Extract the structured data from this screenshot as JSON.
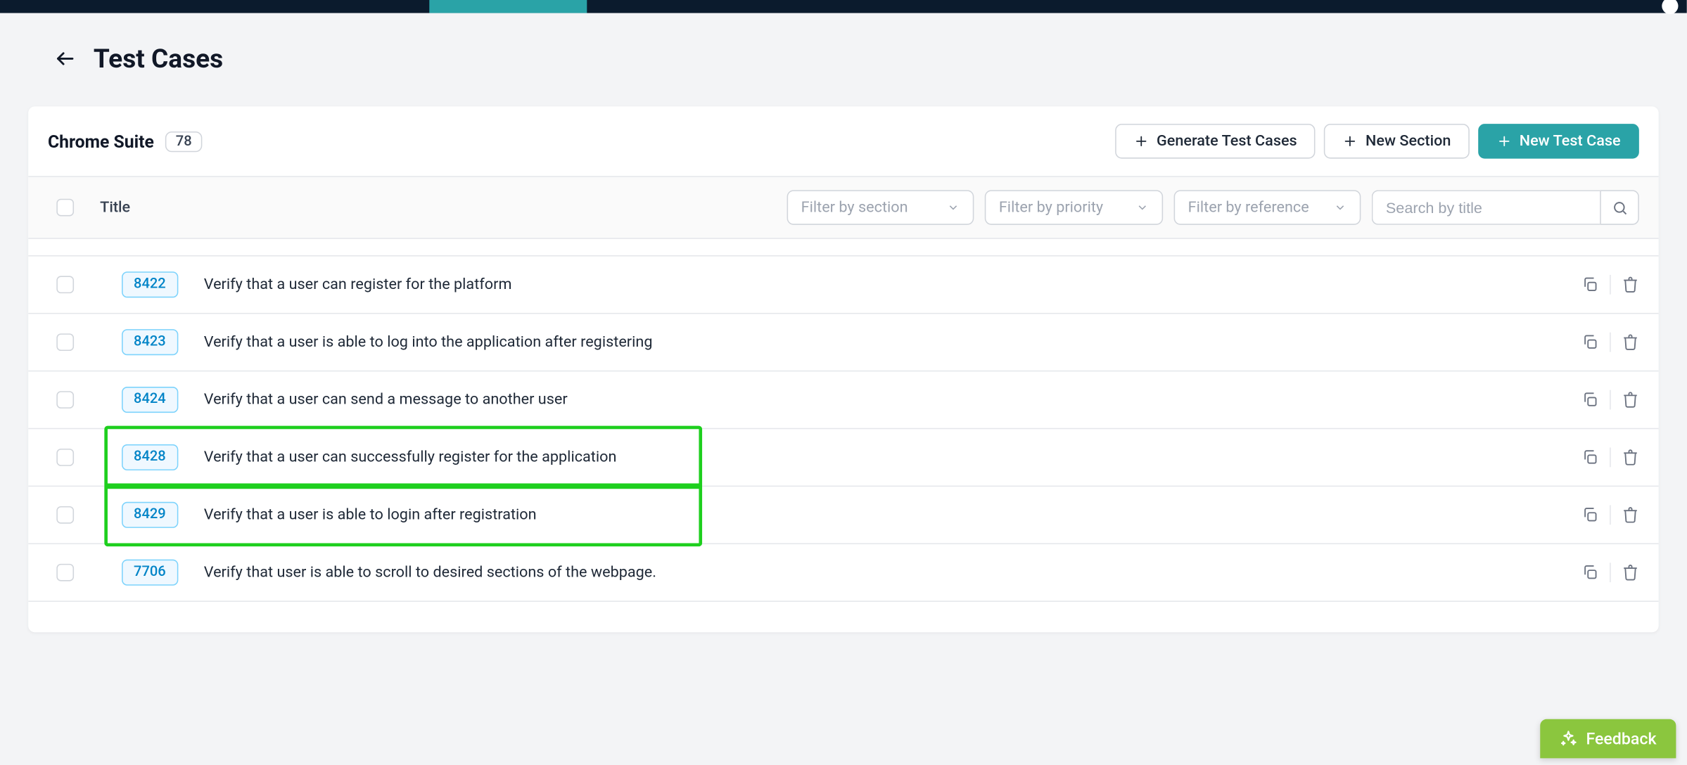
{
  "page": {
    "title": "Test Cases"
  },
  "suite": {
    "name": "Chrome Suite",
    "count": "78"
  },
  "buttons": {
    "generate": "Generate Test Cases",
    "new_section": "New Section",
    "new_test_case": "New Test Case"
  },
  "columns": {
    "title": "Title"
  },
  "filters": {
    "section_placeholder": "Filter by section",
    "priority_placeholder": "Filter by priority",
    "reference_placeholder": "Filter by reference",
    "search_placeholder": "Search by title"
  },
  "rows": [
    {
      "id": "8422",
      "title": "Verify that a user can register for the platform",
      "highlighted": false
    },
    {
      "id": "8423",
      "title": "Verify that a user is able to log into the application after registering",
      "highlighted": false
    },
    {
      "id": "8424",
      "title": "Verify that a user can send a message to another user",
      "highlighted": false
    },
    {
      "id": "8428",
      "title": "Verify that a user can successfully register for the application",
      "highlighted": true
    },
    {
      "id": "8429",
      "title": "Verify that a user is able to login after registration",
      "highlighted": true
    },
    {
      "id": "7706",
      "title": "Verify that user is able to scroll to desired sections of the webpage.",
      "highlighted": false
    }
  ],
  "feedback": {
    "label": "Feedback"
  }
}
